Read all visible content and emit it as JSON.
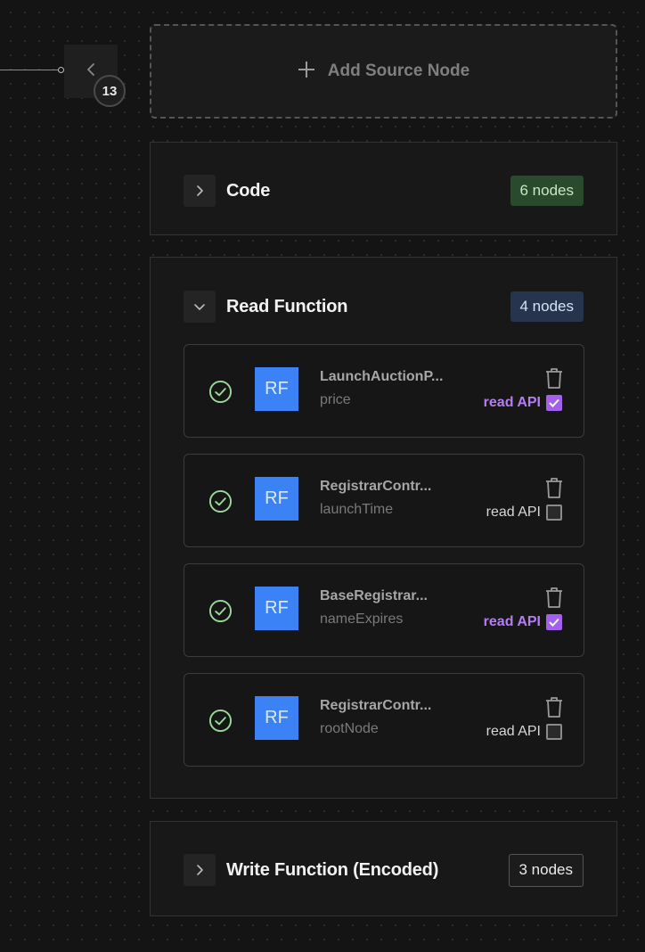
{
  "flow": {
    "collapse_icon": "chevron-left-icon",
    "node_count": "13"
  },
  "add_source": {
    "icon": "plus-icon",
    "label": "Add Source Node"
  },
  "sections": {
    "code": {
      "title": "Code",
      "badge": "6 nodes",
      "expanded": false,
      "badge_color": "#2a4a2e"
    },
    "read_function": {
      "title": "Read Function",
      "badge": "4 nodes",
      "expanded": true,
      "badge_color": "#26354d",
      "nodes": [
        {
          "icon_text": "RF",
          "name": "LaunchAuctionP...",
          "subtitle": "price",
          "read_api_label": "read API",
          "read_api_checked": true
        },
        {
          "icon_text": "RF",
          "name": "RegistrarContr...",
          "subtitle": "launchTime",
          "read_api_label": "read API",
          "read_api_checked": false
        },
        {
          "icon_text": "RF",
          "name": "BaseRegistrar...",
          "subtitle": "nameExpires",
          "read_api_label": "read API",
          "read_api_checked": true
        },
        {
          "icon_text": "RF",
          "name": "RegistrarContr...",
          "subtitle": "rootNode",
          "read_api_label": "read API",
          "read_api_checked": false
        }
      ]
    },
    "write_function": {
      "title": "Write Function (Encoded)",
      "badge": "3 nodes",
      "expanded": false
    }
  },
  "colors": {
    "background": "#141414",
    "accent_purple": "#b57cf5",
    "rf_blue": "#3b82f6",
    "success_green": "#9bd89a"
  }
}
